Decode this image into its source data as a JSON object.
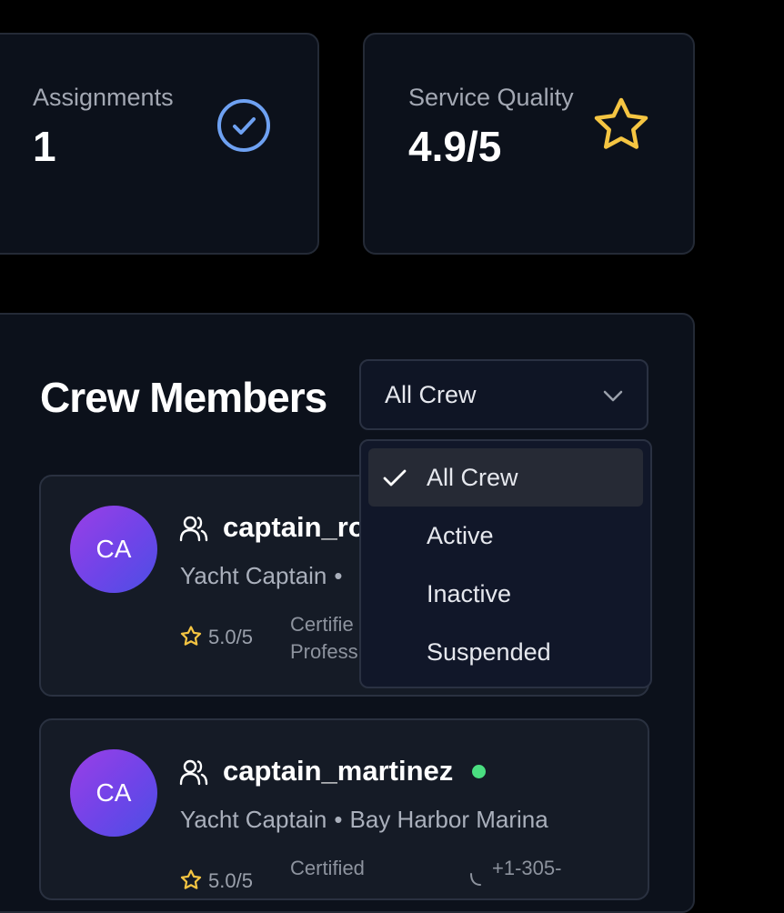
{
  "stats": [
    {
      "label": "Assignments",
      "value": "1",
      "icon": "check-circle-icon"
    },
    {
      "label": "Service Quality",
      "value": "4.9/5",
      "icon": "star-icon"
    }
  ],
  "crew": {
    "title": "Crew Members",
    "filter": {
      "selected": "All Crew",
      "options": [
        "All Crew",
        "Active",
        "Inactive",
        "Suspended"
      ]
    },
    "members": [
      {
        "initials": "CA",
        "name": "captain_ro",
        "role": "Yacht Captain",
        "separator": "•",
        "rating": "5.0/5",
        "cert_line1": "Certifie",
        "cert_line2": "Profess"
      },
      {
        "initials": "CA",
        "name": "captain_martinez",
        "role": "Yacht Captain",
        "separator": "•",
        "location": "Bay Harbor Marina",
        "rating": "5.0/5",
        "cert_line1": "Certified",
        "phone": "+1-305-"
      }
    ]
  },
  "colors": {
    "accent_blue": "#6ea1f2",
    "star_yellow": "#f5c542",
    "online_green": "#4ade80",
    "avatar_gradient_start": "#9a3fe6",
    "avatar_gradient_end": "#4c4fe5"
  }
}
